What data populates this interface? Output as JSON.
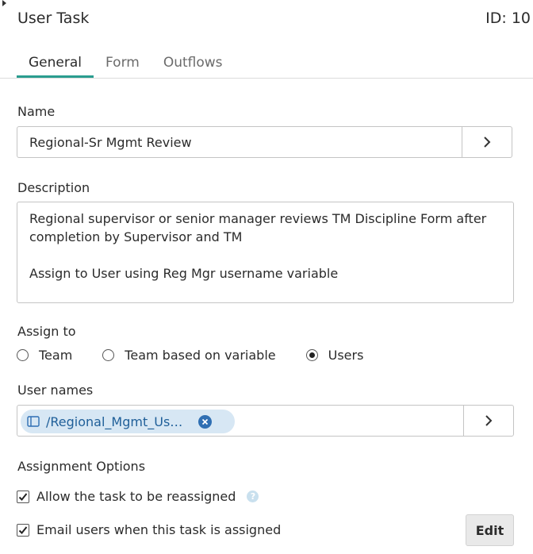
{
  "header": {
    "title": "User Task",
    "id_label": "ID: 10"
  },
  "tabs": [
    {
      "label": "General",
      "active": true
    },
    {
      "label": "Form",
      "active": false
    },
    {
      "label": "Outflows",
      "active": false
    }
  ],
  "name": {
    "label": "Name",
    "value": "Regional-Sr Mgmt Review"
  },
  "description": {
    "label": "Description",
    "value": "Regional supervisor or senior manager reviews TM Discipline Form after completion by Supervisor and TM\n\nAssign to User using Reg Mgr username variable"
  },
  "assign_to": {
    "label": "Assign to",
    "options": [
      {
        "label": "Team",
        "selected": false
      },
      {
        "label": "Team based on variable",
        "selected": false
      },
      {
        "label": "Users",
        "selected": true
      }
    ]
  },
  "user_names": {
    "label": "User names",
    "chip_text": "/Regional_Mgmt_Use..."
  },
  "assignment_options": {
    "label": "Assignment Options",
    "allow_reassign": {
      "label": "Allow the task to be reassigned",
      "checked": true
    },
    "email_users": {
      "label": "Email users when this task is assigned",
      "checked": true
    },
    "edit_label": "Edit"
  },
  "colors": {
    "accent": "#2a9d8f",
    "chip_bg": "#d7e7f4",
    "chip_text": "#1f5f99"
  }
}
